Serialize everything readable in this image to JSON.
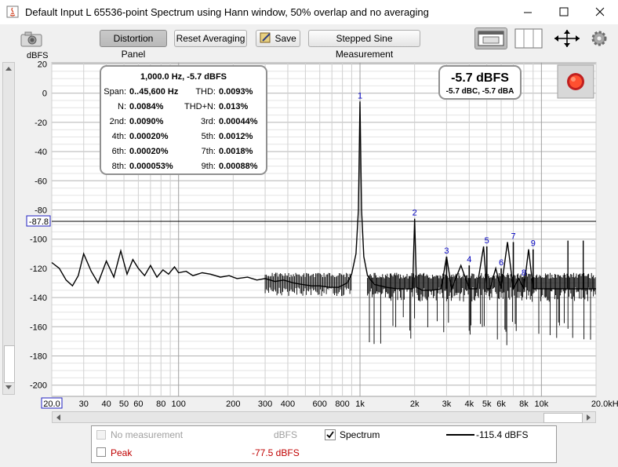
{
  "window": {
    "title": "Default Input L 65536-point Spectrum using Hann window, 50% overlap and no averaging"
  },
  "toolbar": {
    "distortion_panel": "Distortion Panel",
    "reset_averaging": "Reset Averaging",
    "save": "Save",
    "stepped_sine": "Stepped Sine Measurement"
  },
  "y_axis": {
    "unit": "dBFS",
    "ticks": [
      "20",
      "0",
      "-20",
      "-40",
      "-60",
      "-80",
      "-100",
      "-120",
      "-140",
      "-160",
      "-180",
      "-200"
    ],
    "cursor_label": "-87.8"
  },
  "x_axis": {
    "start_label": "20.0",
    "ticks": [
      "30",
      "40",
      "50",
      "60",
      "80",
      "100",
      "200",
      "300",
      "400",
      "600",
      "800",
      "1k",
      "2k",
      "3k",
      "4k",
      "5k",
      "6k",
      "8k",
      "10k",
      "20.0kHz"
    ]
  },
  "distortion": {
    "header": "1,000.0 Hz, -5.7 dBFS",
    "rows": [
      {
        "l1": "Span:",
        "v1": "0..45,600 Hz",
        "l2": "THD:",
        "v2": "0.0093%"
      },
      {
        "l1": "N:",
        "v1": "0.0084%",
        "l2": "THD+N:",
        "v2": "0.013%"
      },
      {
        "l1": "2nd:",
        "v1": "0.0090%",
        "l2": "3rd:",
        "v2": "0.00044%"
      },
      {
        "l1": "4th:",
        "v1": "0.00020%",
        "l2": "5th:",
        "v2": "0.0012%"
      },
      {
        "l1": "6th:",
        "v1": "0.00020%",
        "l2": "7th:",
        "v2": "0.0018%"
      },
      {
        "l1": "8th:",
        "v1": "0.000053%",
        "l2": "9th:",
        "v2": "0.00088%"
      }
    ]
  },
  "level": {
    "main": "-5.7 dBFS",
    "sub": "-5.7 dBC, -5.7 dBA"
  },
  "legend": {
    "no_measurement": "No measurement",
    "no_measurement_unit": "dBFS",
    "spectrum": "Spectrum",
    "spectrum_value": "-115.4 dBFS",
    "peak": "Peak",
    "peak_value": "-77.5 dBFS"
  },
  "colors": {
    "plot_bg": "#ffffff",
    "grid": "#c8c8c8",
    "trace": "#000000",
    "harmonic_label": "#0000c0",
    "peak_label": "#c00000",
    "record_button": "#e02020"
  },
  "chart_data": {
    "type": "line",
    "x_scale": "log",
    "xlim": [
      20,
      20000
    ],
    "ylim": [
      -205,
      20
    ],
    "xlabel": "",
    "ylabel": "dBFS",
    "grid": true,
    "cursor_y": -87.8,
    "series": [
      {
        "name": "Spectrum",
        "x": [
          20,
          22,
          24,
          26,
          28,
          30,
          33,
          36,
          40,
          44,
          48,
          52,
          56,
          60,
          65,
          70,
          76,
          82,
          88,
          95,
          100,
          110,
          120,
          135,
          150,
          170,
          190,
          210,
          240,
          270,
          300,
          340,
          380,
          430,
          480,
          540,
          600,
          680,
          760,
          850,
          900,
          950,
          980,
          1000,
          1020,
          1050,
          1100,
          1200,
          1400,
          1600,
          1800,
          1950,
          2000,
          2050,
          2200,
          2500,
          2800,
          3000,
          3200,
          3600,
          4000,
          4400,
          4800,
          5000,
          5200,
          5600,
          6000,
          6500,
          7000,
          7500,
          8000,
          8500,
          9000,
          9500,
          10000,
          11000,
          12000,
          13000,
          14000,
          15000,
          16000,
          17000,
          18000,
          19000,
          20000
        ],
        "y": [
          -116,
          -120,
          -128,
          -132,
          -125,
          -110,
          -122,
          -130,
          -115,
          -126,
          -108,
          -124,
          -114,
          -120,
          -125,
          -118,
          -126,
          -121,
          -124,
          -119,
          -123,
          -122,
          -125,
          -123,
          -124,
          -126,
          -125,
          -127,
          -126,
          -128,
          -127,
          -129,
          -128,
          -130,
          -131,
          -132,
          -132,
          -133,
          -133,
          -130,
          -124,
          -110,
          -80,
          -5.7,
          -80,
          -112,
          -125,
          -131,
          -133,
          -134,
          -134,
          -134,
          -86,
          -133,
          -135,
          -135,
          -134,
          -112,
          -134,
          -118,
          -134,
          -134,
          -105,
          -134,
          -134,
          -120,
          -134,
          -102,
          -134,
          -127,
          -134,
          -107,
          -134,
          -134,
          -134,
          -134,
          -134,
          -134,
          -134,
          -134,
          -134,
          -134,
          -134,
          -134,
          -134
        ]
      }
    ],
    "harmonics": [
      {
        "label": "1",
        "freq": 1000,
        "db": -5.7
      },
      {
        "label": "2",
        "freq": 2000,
        "db": -86
      },
      {
        "label": "3",
        "freq": 3000,
        "db": -112
      },
      {
        "label": "4",
        "freq": 4000,
        "db": -118
      },
      {
        "label": "5",
        "freq": 5000,
        "db": -105
      },
      {
        "label": "6",
        "freq": 6000,
        "db": -120
      },
      {
        "label": "7",
        "freq": 7000,
        "db": -102
      },
      {
        "label": "8",
        "freq": 8000,
        "db": -127
      },
      {
        "label": "9",
        "freq": 9000,
        "db": -107
      }
    ],
    "tick_values": [
      30,
      40,
      50,
      60,
      80,
      100,
      200,
      300,
      400,
      600,
      800,
      1000,
      2000,
      3000,
      4000,
      5000,
      6000,
      8000,
      10000,
      20000
    ]
  }
}
